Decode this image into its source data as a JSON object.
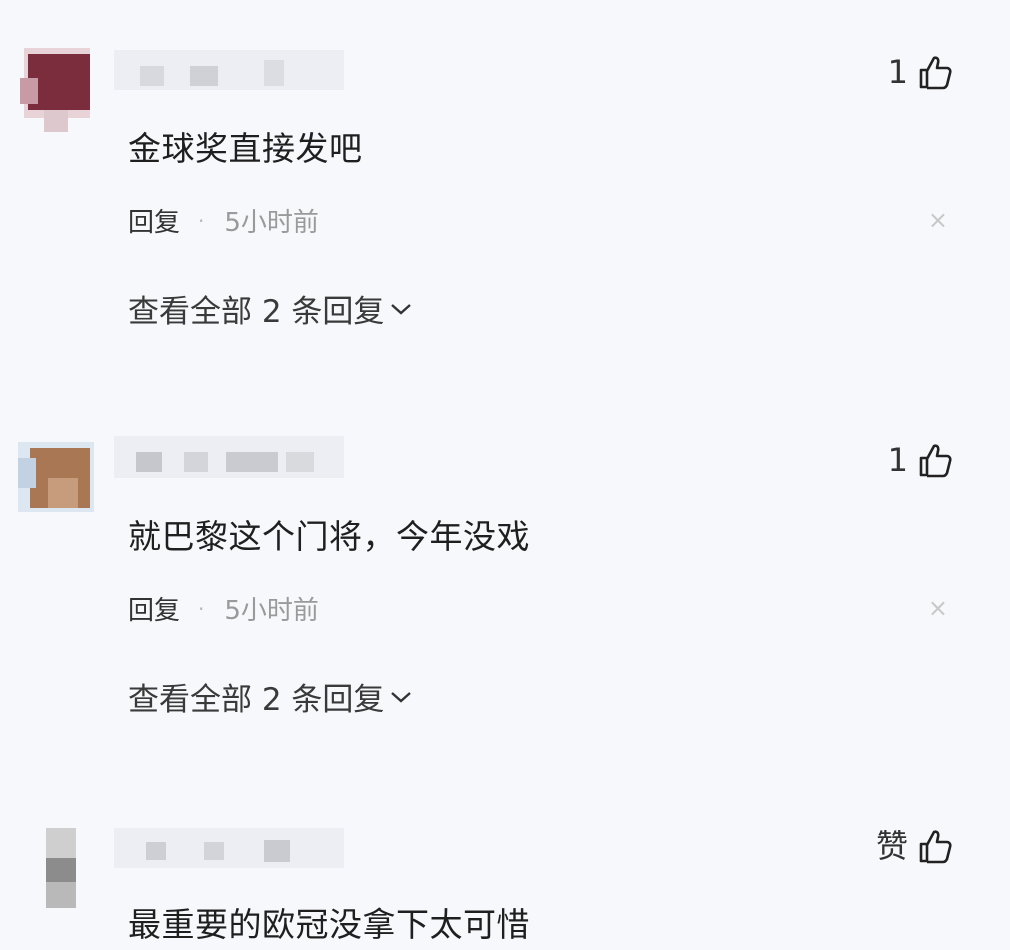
{
  "comments": [
    {
      "text": "金球奖直接发吧",
      "like_count": "1",
      "reply_label": "回复",
      "separator": "·",
      "time": "5小时前",
      "close_glyph": "×",
      "expand_label": "查看全部 2 条回复",
      "avatar_colors": [
        "#7a2b3a",
        "#d9c3c8"
      ]
    },
    {
      "text": "就巴黎这个门将，今年没戏",
      "like_count": "1",
      "reply_label": "回复",
      "separator": "·",
      "time": "5小时前",
      "close_glyph": "×",
      "expand_label": "查看全部 2 条回复",
      "avatar_colors": [
        "#9a6a4a",
        "#cdd9e6"
      ]
    },
    {
      "text": "最重要的欧冠没拿下太可惜",
      "like_label": "赞",
      "avatar_colors": [
        "#8b8b8b",
        "#c7c7c7"
      ]
    }
  ],
  "icons": {
    "like": "thumbs-up-icon",
    "close": "close-icon",
    "expand": "chevron-down-icon"
  }
}
